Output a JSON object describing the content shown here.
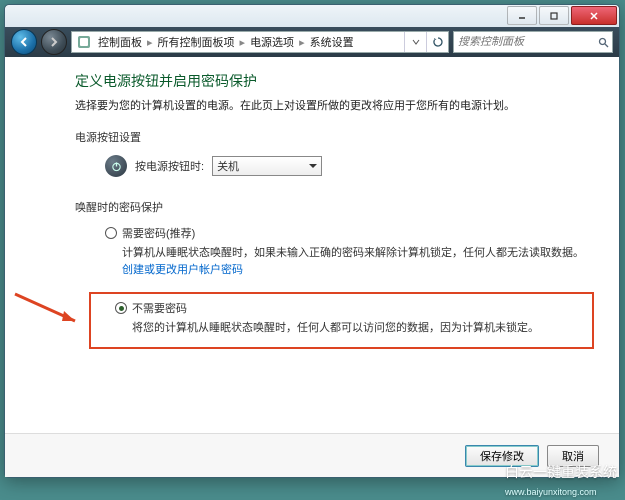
{
  "titlebar": {
    "minimize": "–",
    "maximize": "▢",
    "close": "✕"
  },
  "nav": {
    "crumbs": [
      "控制面板",
      "所有控制面板项",
      "电源选项",
      "系统设置"
    ],
    "search_placeholder": "搜索控制面板"
  },
  "main": {
    "heading": "定义电源按钮并启用密码保护",
    "description": "选择要为您的计算机设置的电源。在此页上对设置所做的更改将应用于您所有的电源计划。",
    "power_button_section": {
      "title": "电源按钮设置",
      "label": "按电源按钮时:",
      "dropdown_value": "关机"
    },
    "wake_section": {
      "title": "唤醒时的密码保护",
      "option1": {
        "label": "需要密码(推荐)",
        "desc_prefix": "计算机从睡眠状态唤醒时，如果未输入正确的密码来解除计算机锁定，任何人都无法读取数据。",
        "link": "创建或更改用户帐户密码"
      },
      "option2": {
        "label": "不需要密码",
        "desc": "将您的计算机从睡眠状态唤醒时，任何人都可以访问您的数据，因为计算机未锁定。"
      },
      "selected": "option2"
    }
  },
  "footer": {
    "save": "保存修改",
    "cancel": "取消"
  },
  "watermark": {
    "title": "白云一键重装系统",
    "url": "www.baiyunxitong.com"
  }
}
